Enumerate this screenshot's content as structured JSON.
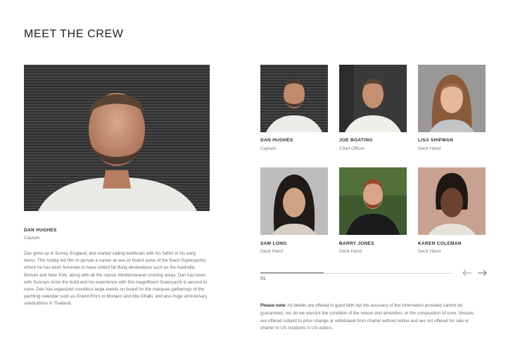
{
  "page": {
    "title": "MEET THE CREW"
  },
  "featured": {
    "name": "DAN HUGHES",
    "role": "Captain",
    "bio": "Dan grew up in Surrey, England, and started sailing keelboats with his father in his early teens. This hobby led him to pursue a career at sea on board some of the finest Superyachts, where he has been fortunate to have visited far flung destinations such as the Australia, Borneo and New York, along with all the classic Mediterranean cruising areas. Dan has been with Sunrays since the build and his experience with this magnificent Superyacht is second to none. Dan has organized countless large events on board for the marquee gatherings of the yachting calendar such as Grand Prix's in Monaco and Abu Dhabi, and also huge anniversary celebrations in Thailand."
  },
  "crew": [
    {
      "name": "DAN HUGHES",
      "role": "Captain"
    },
    {
      "name": "JOE BOATING",
      "role": "Chief Officer"
    },
    {
      "name": "LISA SHIPMAN",
      "role": "Deck Hand"
    },
    {
      "name": "SAM LONG",
      "role": "Deck Hand"
    },
    {
      "name": "BARRY JONES",
      "role": "Deck Hand"
    },
    {
      "name": "KAREN COLEMAN",
      "role": "Deck Hand"
    }
  ],
  "carousel": {
    "page": "01",
    "progress": 0.33
  },
  "note": {
    "label": "Please note:",
    "text": " All details are offered in good faith but the accuracy of the information provided cannot be guaranteed, nor do we warrant the condition of the vessel and amenities, or the composition of crew.  Vessels are offered subject to price change or withdrawal from charter without notice and are not offered for sale or charter to US residents in US waters."
  },
  "icons": {
    "prev": "arrow-left-icon",
    "next": "arrow-right-icon"
  },
  "colors": {
    "text": "#3a3a3a",
    "muted": "#7b7b7b",
    "track": "#d6d6d6",
    "fill": "#9c9c9c"
  }
}
